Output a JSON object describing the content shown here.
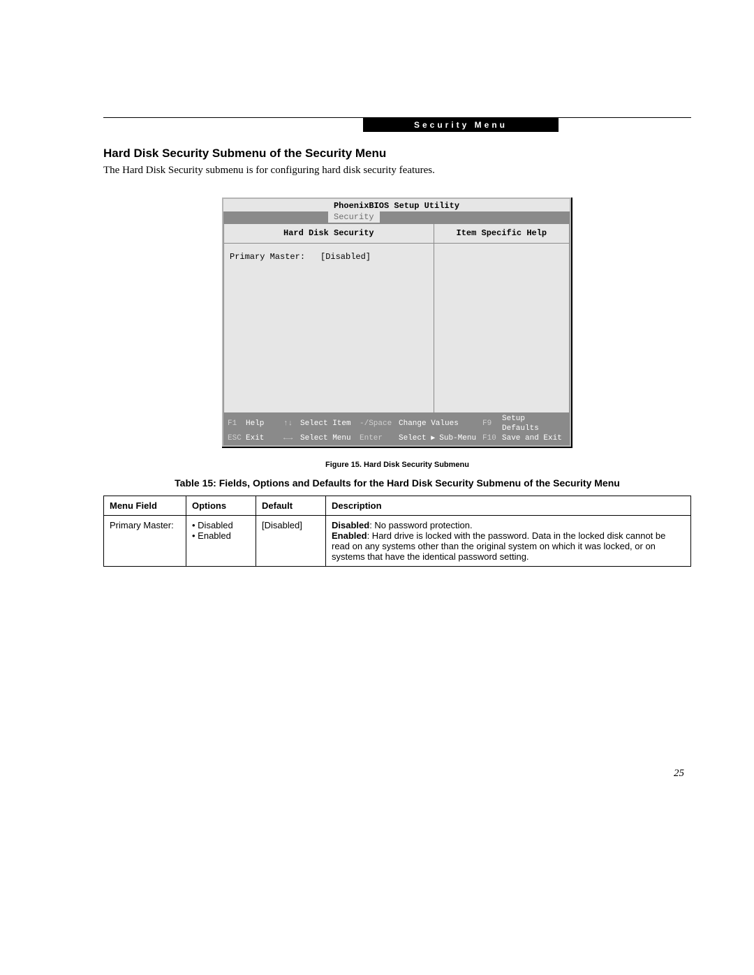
{
  "header": {
    "tab_label": "Security Menu"
  },
  "section": {
    "title": "Hard Disk Security Submenu of the Security Menu",
    "intro": "The Hard Disk Security submenu is for configuring hard disk security features."
  },
  "bios": {
    "utility_title": "PhoenixBIOS Setup Utility",
    "active_tab": "Security",
    "left_header": "Hard Disk Security",
    "right_header": "Item Specific Help",
    "items": [
      {
        "label": "Primary Master:",
        "value": "[Disabled]"
      }
    ],
    "footer": {
      "f1": "F1",
      "f1_label": "Help",
      "up_down_arrows": "↑↓",
      "up_down_label": "Select Item",
      "minus_space": "-/Space",
      "minus_space_label": "Change Values",
      "f9": "F9",
      "f9_label": "Setup Defaults",
      "esc": "ESC",
      "esc_label": "Exit",
      "left_right_arrows": "←→",
      "left_right_label": "Select Menu",
      "enter": "Enter",
      "enter_label_prefix": "Select",
      "enter_label_suffix": "Sub-Menu",
      "f10": "F10",
      "f10_label": "Save and Exit"
    }
  },
  "figure_caption": "Figure 15.   Hard Disk Security Submenu",
  "table": {
    "title": "Table 15: Fields, Options and Defaults for the Hard Disk Security Submenu of the Security Menu",
    "headers": [
      "Menu Field",
      "Options",
      "Default",
      "Description"
    ],
    "rows": [
      {
        "field": "Primary Master:",
        "options": [
          "Disabled",
          "Enabled"
        ],
        "default": "[Disabled]",
        "desc_disabled_label": "Disabled",
        "desc_disabled_text": ": No password protection.",
        "desc_enabled_label": "Enabled",
        "desc_enabled_text": ": Hard drive is locked with the password. Data in the locked disk cannot be read on any systems other than the original system on which it was locked, or on systems that have the identical password setting."
      }
    ]
  },
  "page_number": "25"
}
